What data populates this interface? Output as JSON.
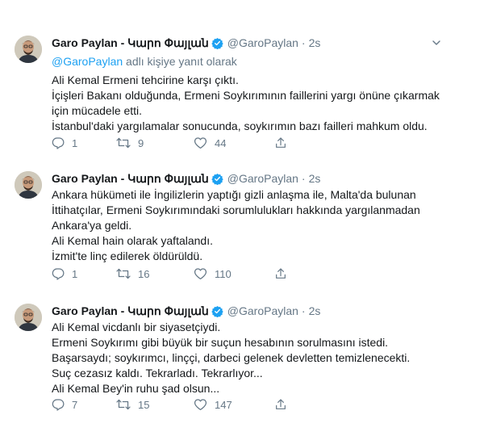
{
  "tweets": [
    {
      "name": "Garo Paylan - Կարո Փայլան",
      "handle": "@GaroPaylan",
      "dot": "·",
      "time": "2s",
      "reply_prefix": "",
      "reply_mention": "@GaroPaylan",
      "reply_suffix": " adlı kişiye yanıt olarak",
      "lines": [
        "Ali Kemal Ermeni tehcirine karşı çıktı.",
        "İçişleri Bakanı olduğunda, Ermeni Soykırımının faillerini yargı önüne çıkarmak",
        "için mücadele etti.",
        "İstanbul'daki yargılamalar sonucunda, soykırımın bazı failleri mahkum oldu."
      ],
      "replies": "1",
      "retweets": "9",
      "likes": "44"
    },
    {
      "name": "Garo Paylan - Կարո Փայլան",
      "handle": "@GaroPaylan",
      "dot": "·",
      "time": "2s",
      "lines": [
        "Ankara hükümeti ile İngilizlerin yaptığı gizli anlaşma ile, Malta'da bulunan",
        "İttihatçılar, Ermeni Soykırımındaki sorumlulukları hakkında yargılanmadan",
        "Ankara'ya geldi.",
        "Ali Kemal hain olarak yaftalandı.",
        "İzmit'te linç edilerek öldürüldü."
      ],
      "replies": "1",
      "retweets": "16",
      "likes": "110"
    },
    {
      "name": "Garo Paylan - Կարո Փայլան",
      "handle": "@GaroPaylan",
      "dot": "·",
      "time": "2s",
      "lines": [
        "Ali Kemal vicdanlı bir siyasetçiydi.",
        "Ermeni Soykırımı gibi büyük bir suçun hesabının sorulmasını istedi.",
        "Başarsaydı; soykırımcı, linççi, darbeci gelenek devletten temizlenecekti.",
        "Suç cezasız kaldı. Tekrarladı. Tekrarlıyor...",
        "Ali Kemal Bey'in ruhu şad olsun..."
      ],
      "replies": "7",
      "retweets": "15",
      "likes": "147"
    }
  ],
  "icons": {
    "verified": "verified-badge-icon",
    "caret": "chevron-down-icon",
    "reply": "reply-icon",
    "retweet": "retweet-icon",
    "like": "heart-icon",
    "share": "share-icon"
  },
  "colors": {
    "accent": "#1da1f2",
    "text": "#14171a",
    "muted": "#657786"
  }
}
